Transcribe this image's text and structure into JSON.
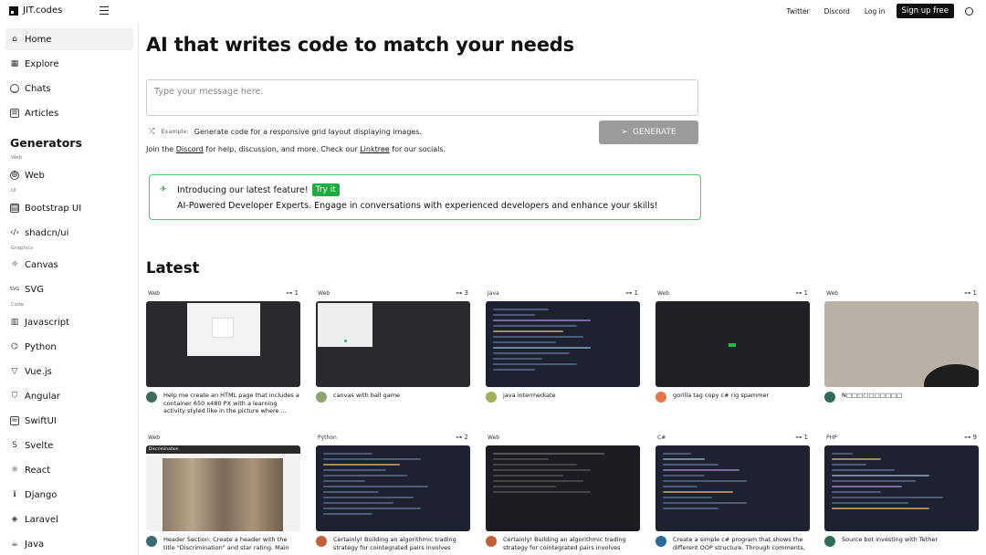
{
  "topbar": {
    "brand": "JIT.codes",
    "links": [
      "Twitter",
      "Discord",
      "Log in"
    ],
    "signup": "Sign up free"
  },
  "sidebar": {
    "home": "Home",
    "explore": "Explore",
    "chats": "Chats",
    "articles": "Articles",
    "generators_title": "Generators",
    "groups": {
      "web": "Web",
      "ui": "UI",
      "graphics": "Graphics",
      "code": "Code"
    },
    "items": {
      "web": "Web",
      "bootstrap": "Bootstrap UI",
      "shadcn": "shadcn/ui",
      "canvas": "Canvas",
      "svg": "SVG",
      "svg_icon": "SVG",
      "javascript": "Javascript",
      "python": "Python",
      "vue": "Vue.js",
      "angular": "Angular",
      "swiftui": "SwiftUI",
      "svelte": "Svelte",
      "react": "React",
      "django": "Django",
      "laravel": "Laravel",
      "java": "Java"
    }
  },
  "main": {
    "hero": "AI that writes code to match your needs",
    "prompt_placeholder": "Type your message here.",
    "example_label": "Example:",
    "example_text": "Generate code for a responsive grid layout displaying images.",
    "generate": "GENERATE",
    "join_pre": "Join the",
    "join_discord": "Discord",
    "join_mid": "for help, discussion, and more. Check our",
    "join_linktree": "Linktree",
    "join_post": "for our socials.",
    "feature_title": "Introducing our latest feature!",
    "feature_try": "Try it",
    "feature_desc": "AI-Powered Developer Experts. Engage in conversations with experienced developers and enhance your skills!",
    "latest": "Latest"
  },
  "cards": [
    {
      "lang": "Web",
      "likes": "1",
      "title": "Help me create an HTML page that includes a container 650 x480 PX with a learning activity styled like in the picture where ..."
    },
    {
      "lang": "Web",
      "likes": "3",
      "title": "canvas with ball game"
    },
    {
      "lang": "Java",
      "likes": "1",
      "title": "java intermediate"
    },
    {
      "lang": "Web",
      "likes": "1",
      "title": "gorilla tag copy c# rig spammer"
    },
    {
      "lang": "Web",
      "likes": "1",
      "title": "N□□□□□□□□□□"
    },
    {
      "lang": "Web",
      "likes": "",
      "title": "Header Section: Create a header with the title \"Discrimination\" and star rating. Main"
    },
    {
      "lang": "Python",
      "likes": "2",
      "title": "Certainly! Building an algorithmic trading strategy for cointegrated pairs involves"
    },
    {
      "lang": "Web",
      "likes": "",
      "title": "Certainly! Building an algorithmic trading strategy for cointegrated pairs involves"
    },
    {
      "lang": "C#",
      "likes": "1",
      "title": "Create a simple c# program that shows the different OOP structure. Through comments,"
    },
    {
      "lang": "PHP",
      "likes": "9",
      "title": "Source bot investing with Tether"
    }
  ],
  "thumb_text": {
    "discrimination": "Discrimination"
  },
  "colors": {
    "accent_green": "#1faa44",
    "feature_border": "#4ccb6a",
    "generate_bg": "#9b9b9b"
  }
}
